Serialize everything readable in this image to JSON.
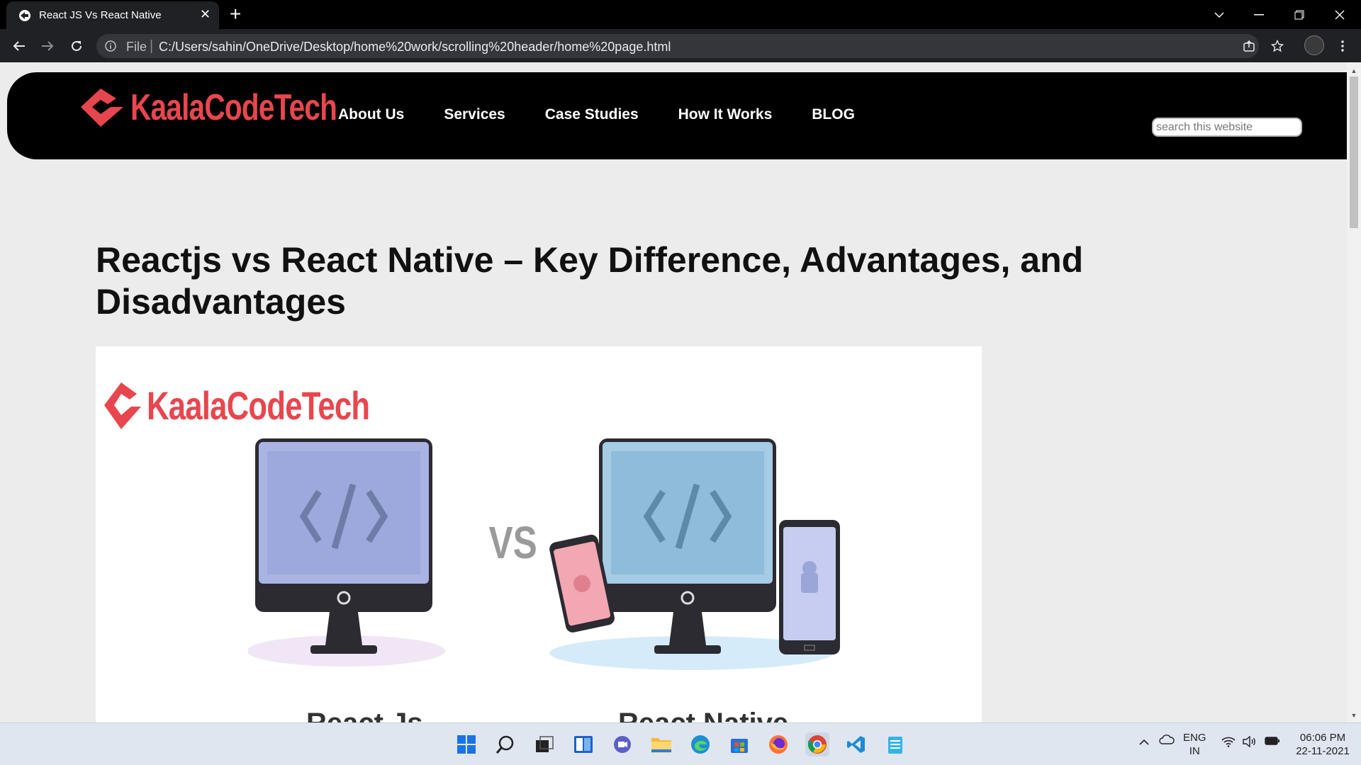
{
  "browser": {
    "tab_title": "React JS Vs React Native",
    "address_scheme": "File",
    "address_url": "C:/Users/sahin/OneDrive/Desktop/home%20work/scrolling%20header/home%20page.html"
  },
  "site": {
    "logo_text": "KaalaCodeTech",
    "nav": [
      "About Us",
      "Services",
      "Case Studies",
      "How It Works",
      "BLOG"
    ],
    "search_placeholder": "search this website"
  },
  "article": {
    "headline": "Reactjs vs React Native – Key Difference, Advantages, and Disadvantages",
    "image": {
      "logo_text": "KaalaCodeTech",
      "vs_text": "VS",
      "left_caption": "React Js",
      "right_caption": "React Native"
    }
  },
  "taskbar": {
    "lang_line1": "ENG",
    "lang_line2": "IN",
    "time": "06:06 PM",
    "date": "22-11-2021"
  },
  "colors": {
    "brand_red": "#e8464e",
    "header_black": "#000000",
    "page_bg": "#ececec"
  }
}
